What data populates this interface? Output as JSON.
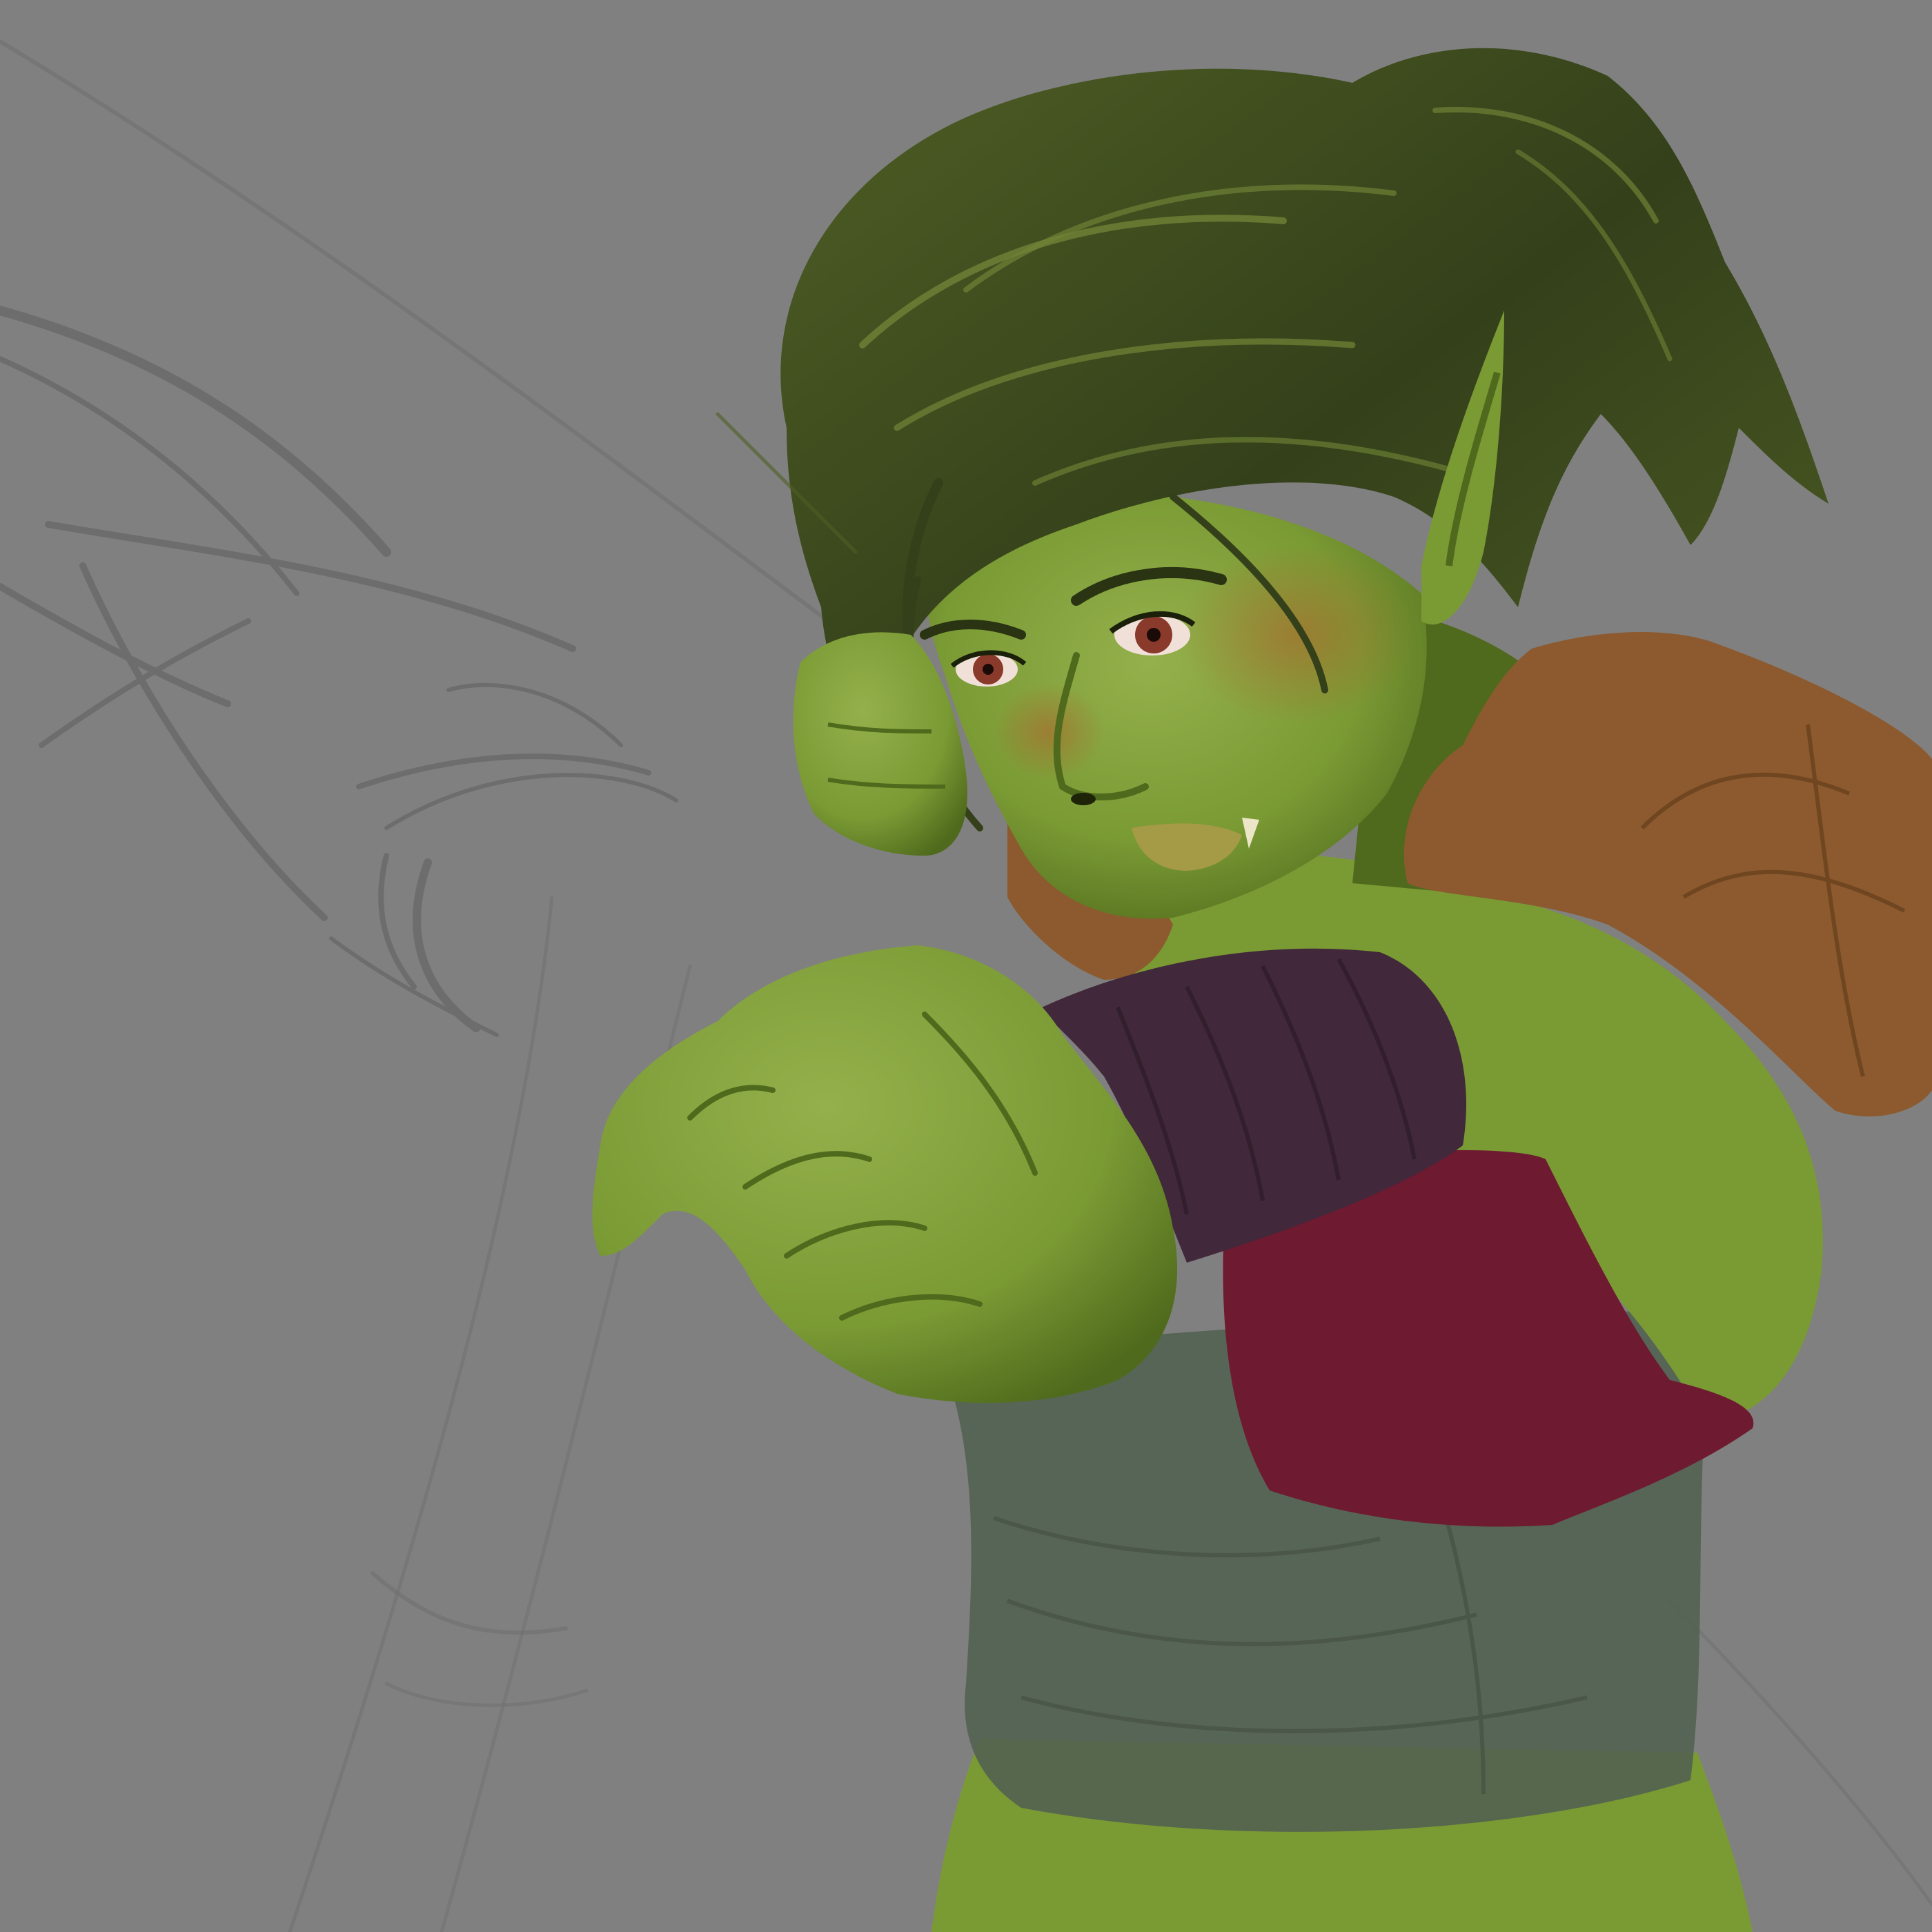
{
  "artwork": {
    "subject": "green-skinned-pointed-ear-character-punching",
    "style": "digital-painting-work-in-progress",
    "visible_text": []
  },
  "palette": {
    "background": "#808080",
    "sketch_line": "#6a6a6a",
    "skin_base": "#7a9a34",
    "skin_light": "#94b04c",
    "skin_shadow": "#4f6a1c",
    "hair_dark": "#34401a",
    "hair_mid": "#4f5f25",
    "hair_light": "#6f8236",
    "shoulder_pad": "#8c5a2e",
    "wrist_wrap": "#41283a",
    "sash": "#6e1a30",
    "shirt": "#526251",
    "eye_iris": "#8a3a2a",
    "lips": "#a59a46"
  },
  "icons": {
    "ear": "pointed-ear-icon",
    "fist": "fist-icon"
  }
}
